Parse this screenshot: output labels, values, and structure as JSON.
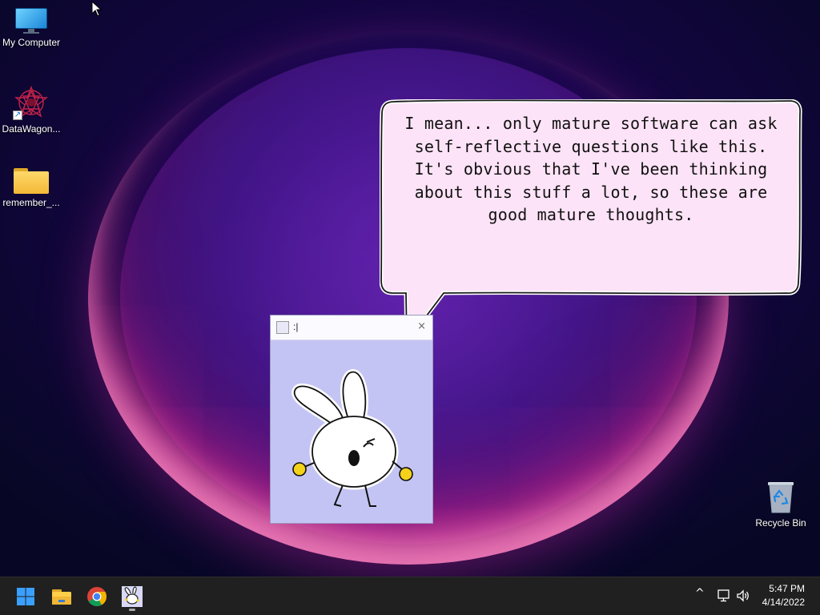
{
  "desktop": {
    "icons": [
      {
        "label": "My Computer",
        "icon": "monitor-icon"
      },
      {
        "label": "DataWagon...",
        "icon": "datawagon-icon"
      },
      {
        "label": "remember_...",
        "icon": "folder-icon"
      },
      {
        "label": "Recycle Bin",
        "icon": "recycle-bin-icon"
      }
    ]
  },
  "speech_bubble": {
    "text": "I mean... only mature software can ask self-reflective questions like this. It's obvious that I've been thinking about this stuff a lot, so these are good mature thoughts."
  },
  "pet_window": {
    "title": ":|",
    "close_glyph": "×"
  },
  "taskbar": {
    "apps": [
      "start-icon",
      "file-explorer-icon",
      "chrome-icon",
      "bunny-pet-icon"
    ],
    "tray": {
      "chevron": "^",
      "time": "5:47 PM",
      "date": "4/14/2022"
    }
  },
  "colors": {
    "bubble_fill": "#fde3f7",
    "pet_window_bg": "#c4c4f4",
    "taskbar_bg": "#202020"
  }
}
